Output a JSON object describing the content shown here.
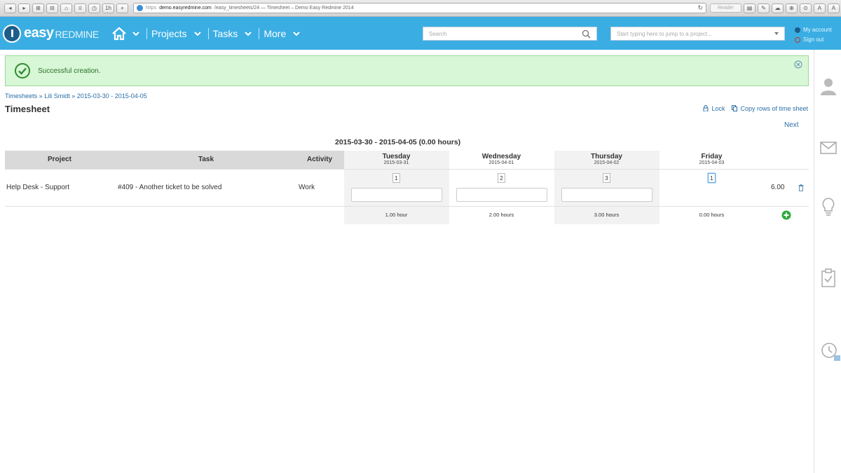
{
  "browser": {
    "buttons": [
      "◂",
      "▸",
      "⊞",
      "⊟",
      "⌂",
      "♕",
      "◷",
      "1h",
      "+"
    ],
    "url_scheme": "https",
    "url_host": "demo.easyredmine.com",
    "url_path": "/easy_timesheets/24 — Timesheet – Demo Easy Redmine 2014",
    "reader_label": "Reader",
    "right_buttons": [
      "▤",
      "✎",
      "☁",
      "⊕",
      "⊙",
      "A",
      "A"
    ]
  },
  "header": {
    "logo_easy": "easy",
    "logo_redmine": "REDMINE",
    "nav": [
      "Projects",
      "Tasks",
      "More"
    ],
    "search_placeholder": "Search",
    "jump_placeholder": "Start typing here to jump to a project...",
    "my_account": "My account",
    "sign_out": "Sign out"
  },
  "flash": {
    "message": "Successful creation."
  },
  "breadcrumb": "Timesheets » Lili Smidt » 2015-03-30 - 2015-04-05",
  "page_title": "Timesheet",
  "actions": {
    "lock": "Lock",
    "copy_rows": "Copy rows of time sheet"
  },
  "next_label": "Next",
  "period": "2015-03-30 - 2015-04-05 (0.00 hours)",
  "table": {
    "headers": {
      "project": "Project",
      "task": "Task",
      "activity": "Activity"
    },
    "days": [
      {
        "name": "Tuesday",
        "date": "2015-03-31",
        "value": "1",
        "total": "1.00 hour"
      },
      {
        "name": "Wednesday",
        "date": "2015-04-01",
        "value": "2",
        "total": "2.00 hours"
      },
      {
        "name": "Thursday",
        "date": "2015-04-02",
        "value": "3",
        "total": "3.00 hours"
      },
      {
        "name": "Friday",
        "date": "2015-04-03",
        "value": "1",
        "total": "0.00 hours"
      }
    ],
    "row": {
      "project": "Help Desk - Support",
      "task": "#409 - Another ticket to be solved",
      "activity": "Work",
      "total": "6.00"
    }
  },
  "colors": {
    "header_bg": "#3aaee3",
    "flash_bg": "#d7f7d6",
    "link": "#2a6ea6",
    "add_green": "#2eaa3a"
  }
}
